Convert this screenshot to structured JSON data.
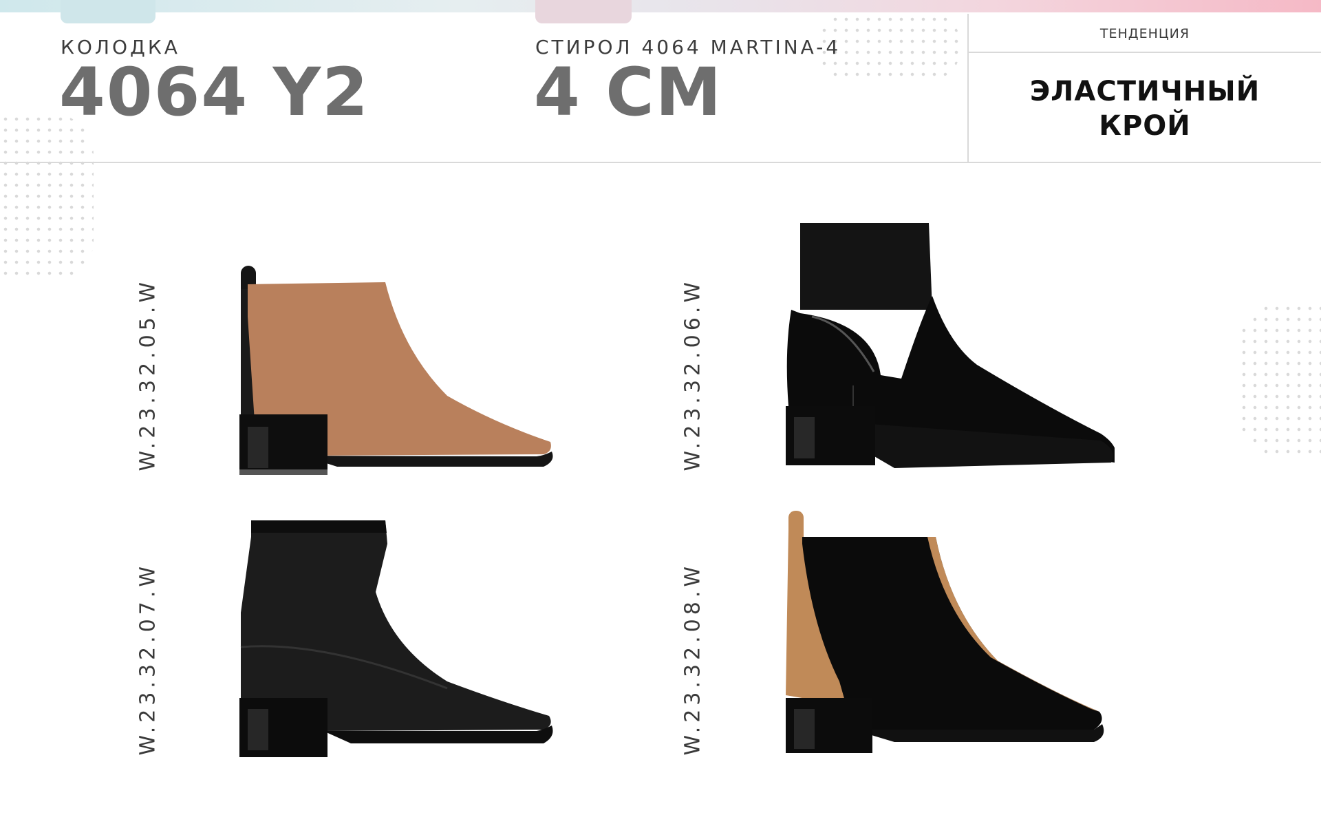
{
  "header": {
    "last": {
      "label": "КОЛОДКА",
      "value": "4064 Y2"
    },
    "heel": {
      "label": "СТИРОЛ 4064 MARTINA-4",
      "value": "4 СМ"
    },
    "trend": {
      "title": "ТЕНДЕНЦИЯ",
      "value_line1": "ЭЛАСТИЧНЫЙ",
      "value_line2": "КРОЙ"
    }
  },
  "products": [
    {
      "code": "W.23.32.05.W",
      "icon": "tan-ankle-boot-icon",
      "color": "#b9805c"
    },
    {
      "code": "W.23.32.06.W",
      "icon": "black-patent-suede-boot-icon",
      "color": "#0c0c0c"
    },
    {
      "code": "W.23.32.07.W",
      "icon": "black-leather-sock-boot-icon",
      "color": "#1c1c1c"
    },
    {
      "code": "W.23.32.08.W",
      "icon": "black-tan-colorblock-boot-icon",
      "color": "#c08a58"
    }
  ]
}
